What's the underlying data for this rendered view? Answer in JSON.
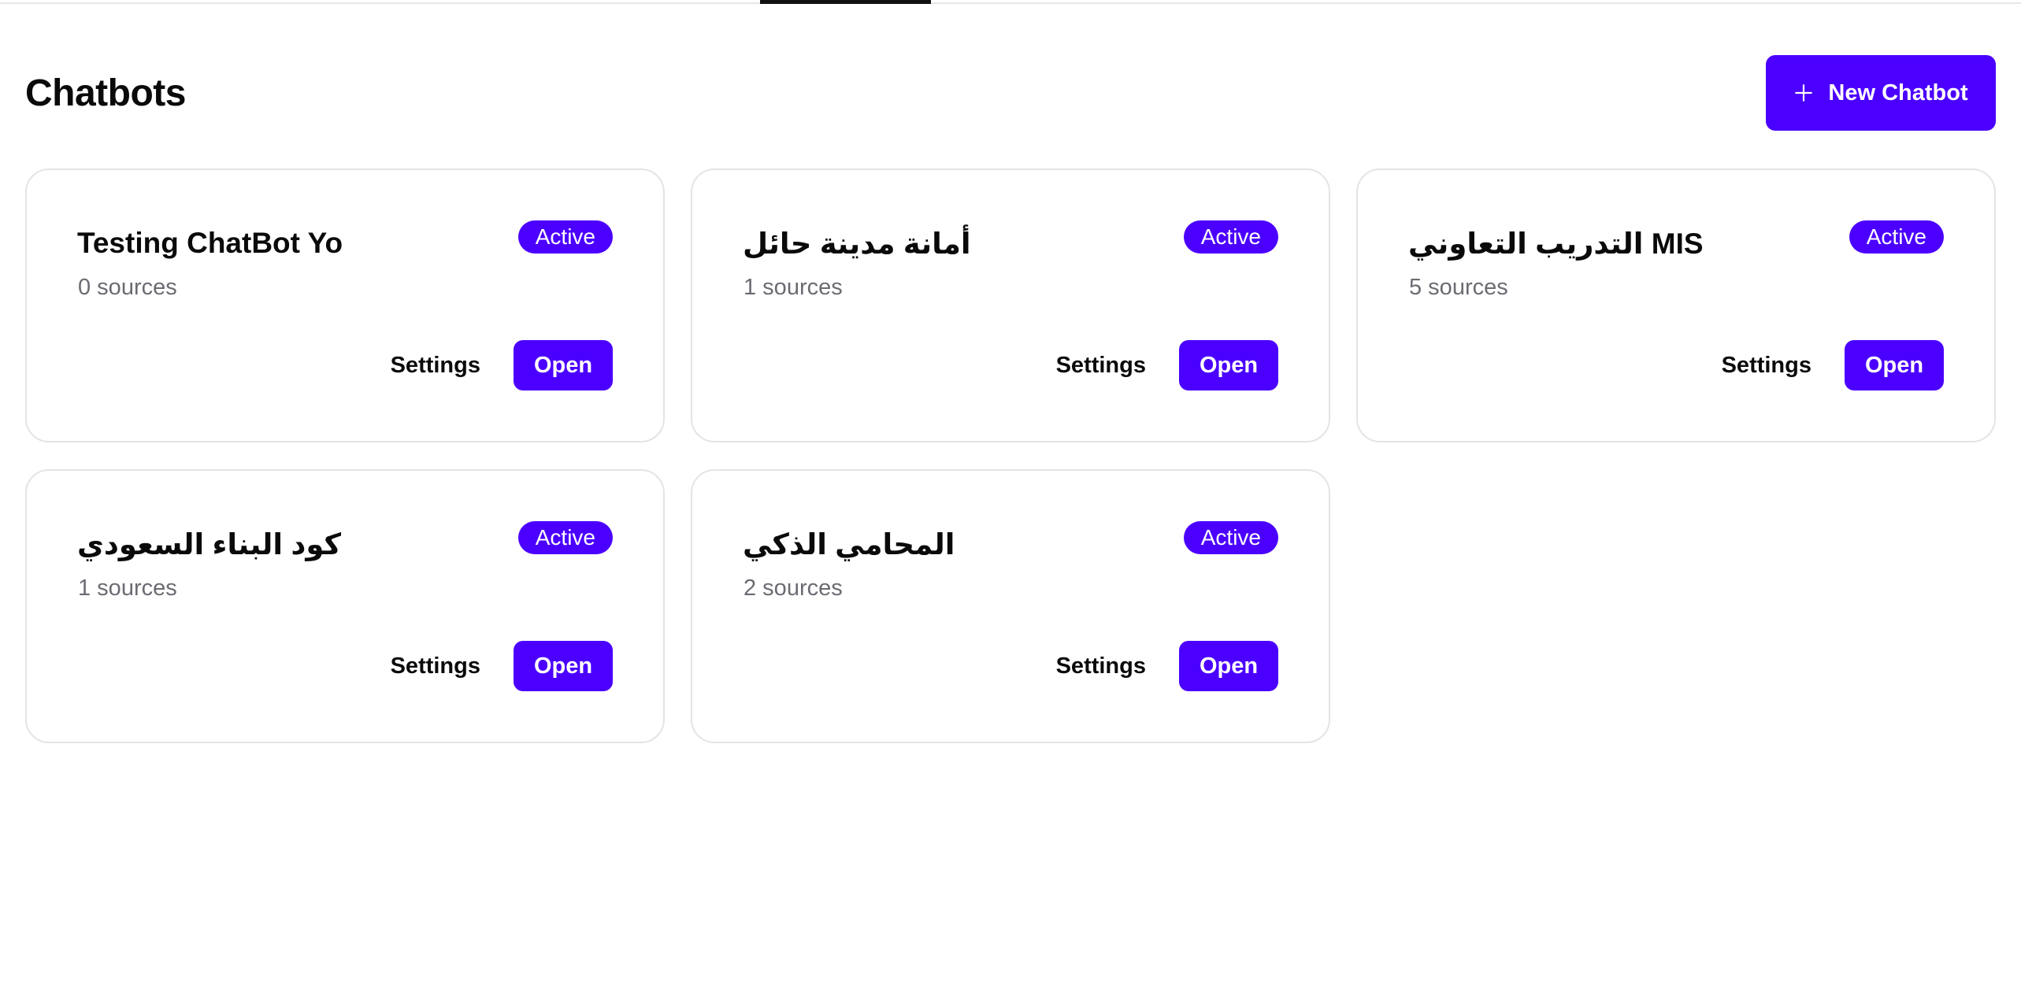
{
  "page": {
    "title": "Chatbots",
    "new_button_label": "New Chatbot"
  },
  "colors": {
    "accent": "#4b00ff",
    "border": "#e4e4e7",
    "muted_text": "#6b6b73"
  },
  "icons": {
    "new_button": "plus-icon"
  },
  "chatbots": [
    {
      "name": "Testing ChatBot Yo",
      "sources": "0 sources",
      "status": "Active",
      "settings_label": "Settings",
      "open_label": "Open"
    },
    {
      "name": "أمانة مدينة حائل",
      "sources": "1 sources",
      "status": "Active",
      "settings_label": "Settings",
      "open_label": "Open"
    },
    {
      "name": "التدريب التعاوني MIS",
      "sources": "5 sources",
      "status": "Active",
      "settings_label": "Settings",
      "open_label": "Open"
    },
    {
      "name": "كود البناء السعودي",
      "sources": "1 sources",
      "status": "Active",
      "settings_label": "Settings",
      "open_label": "Open"
    },
    {
      "name": "المحامي الذكي",
      "sources": "2 sources",
      "status": "Active",
      "settings_label": "Settings",
      "open_label": "Open"
    }
  ]
}
